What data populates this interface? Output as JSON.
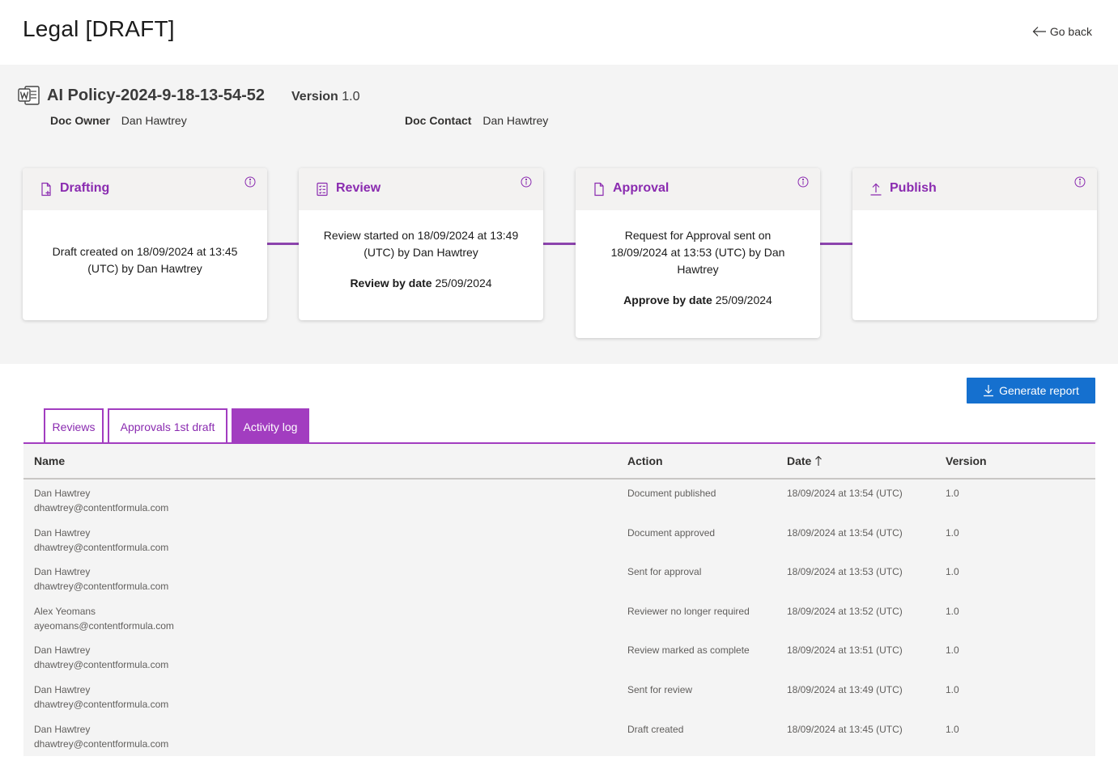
{
  "header": {
    "title": "Legal [DRAFT]",
    "go_back_label": "Go back"
  },
  "document": {
    "name": "AI Policy-2024-9-18-13-54-52",
    "version_label": "Version",
    "version_value": "1.0",
    "owner_label": "Doc Owner",
    "owner_value": "Dan Hawtrey",
    "contact_label": "Doc Contact",
    "contact_value": "Dan Hawtrey"
  },
  "stages": {
    "drafting": {
      "title": "Drafting",
      "text": "Draft created on 18/09/2024 at 13:45 (UTC) by Dan Hawtrey"
    },
    "review": {
      "title": "Review",
      "text": "Review started on 18/09/2024 at 13:49 (UTC) by Dan Hawtrey",
      "due_label": "Review by date",
      "due_value": "25/09/2024"
    },
    "approval": {
      "title": "Approval",
      "text": "Request for Approval sent on 18/09/2024 at 13:53 (UTC) by Dan Hawtrey",
      "due_label": "Approve by date",
      "due_value": "25/09/2024"
    },
    "publish": {
      "title": "Publish"
    }
  },
  "actions": {
    "generate_report_label": "Generate report"
  },
  "tabs": {
    "reviews": "Reviews",
    "approvals": "Approvals 1st draft",
    "activity": "Activity log",
    "active": "activity"
  },
  "table": {
    "headers": {
      "name": "Name",
      "action": "Action",
      "date": "Date",
      "version": "Version"
    },
    "rows": [
      {
        "name": "Dan Hawtrey",
        "email": "dhawtrey@contentformula.com",
        "action": "Document published",
        "date": "18/09/2024 at 13:54 (UTC)",
        "version": "1.0"
      },
      {
        "name": "Dan Hawtrey",
        "email": "dhawtrey@contentformula.com",
        "action": "Document approved",
        "date": "18/09/2024 at 13:54 (UTC)",
        "version": "1.0"
      },
      {
        "name": "Dan Hawtrey",
        "email": "dhawtrey@contentformula.com",
        "action": "Sent for approval",
        "date": "18/09/2024 at 13:53 (UTC)",
        "version": "1.0"
      },
      {
        "name": "Alex Yeomans",
        "email": "ayeomans@contentformula.com",
        "action": "Reviewer no longer required",
        "date": "18/09/2024 at 13:52 (UTC)",
        "version": "1.0"
      },
      {
        "name": "Dan Hawtrey",
        "email": "dhawtrey@contentformula.com",
        "action": "Review marked as complete",
        "date": "18/09/2024 at 13:51 (UTC)",
        "version": "1.0"
      },
      {
        "name": "Dan Hawtrey",
        "email": "dhawtrey@contentformula.com",
        "action": "Sent for review",
        "date": "18/09/2024 at 13:49 (UTC)",
        "version": "1.0"
      },
      {
        "name": "Dan Hawtrey",
        "email": "dhawtrey@contentformula.com",
        "action": "Draft created",
        "date": "18/09/2024 at 13:45 (UTC)",
        "version": "1.0"
      }
    ]
  },
  "icons": {
    "doc": "word-document-icon",
    "back": "arrow-left-icon",
    "drafting": "document-add-icon",
    "review": "checklist-icon",
    "approval": "document-icon",
    "publish": "upload-icon",
    "info": "info-icon",
    "download": "download-icon",
    "sort": "arrow-up-icon"
  },
  "colors": {
    "accent": "#8a2bb0",
    "tab_active": "#a23dc0",
    "primary_button": "#1570cf",
    "panel_bg": "#f4f4f4"
  }
}
